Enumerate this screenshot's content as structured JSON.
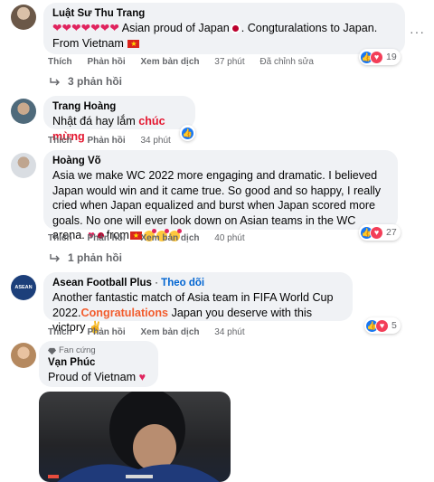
{
  "comments": [
    {
      "author": "Luật Sư Thu Trang",
      "text_a": "Asian proud of Japan",
      "text_b": ". Congturalations to Japan.",
      "text_c": "From Vietnam",
      "actions": {
        "like": "Thích",
        "reply": "Phản hồi",
        "translate": "Xem bản dịch",
        "time": "37 phút",
        "edited": "Đã chỉnh sửa"
      },
      "reactions": "19",
      "replies": "3 phản hồi"
    },
    {
      "author": "Trang Hoàng",
      "text_a": "Nhật đá hay lắm",
      "text_hl": "chúc mừng",
      "actions": {
        "like": "Thích",
        "reply": "Phản hồi",
        "time": "34 phút"
      }
    },
    {
      "author": "Hoàng Võ",
      "text_a": "Asia we make WC 2022 more engaging and dramatic. I believed Japan would win and it came true. So good and so happy, I really cried when Japan equalized and burst when Japan scored more goals. No one will ever look down on Asian teams in the WC arena.",
      "text_b": "from",
      "actions": {
        "like": "Thích",
        "reply": "Phản hồi",
        "translate": "Xem bản dịch",
        "time": "40 phút"
      },
      "reactions": "27",
      "replies": "1 phản hồi"
    },
    {
      "author": "Asean Football Plus",
      "follow_sep": "·",
      "follow": "Theo dõi",
      "avatar_text": "ASEAN",
      "text_a": "Another fantastic match of Asia team in FIFA World Cup 2022.",
      "text_hl": "Congratulations",
      "text_b": "Japan you deserve with this victory",
      "actions": {
        "like": "Thích",
        "reply": "Phản hồi",
        "translate": "Xem bản dịch",
        "time": "34 phút"
      },
      "reactions": "5"
    },
    {
      "badge": "Fan cứng",
      "author": "Vạn Phúc",
      "text_a": "Proud of Vietnam"
    }
  ],
  "more_menu": "···",
  "colors": {
    "bubble": "#f0f2f5",
    "muted": "#65676b",
    "like": "#1877f2",
    "love": "#f33e58",
    "link": "#0064d1"
  }
}
